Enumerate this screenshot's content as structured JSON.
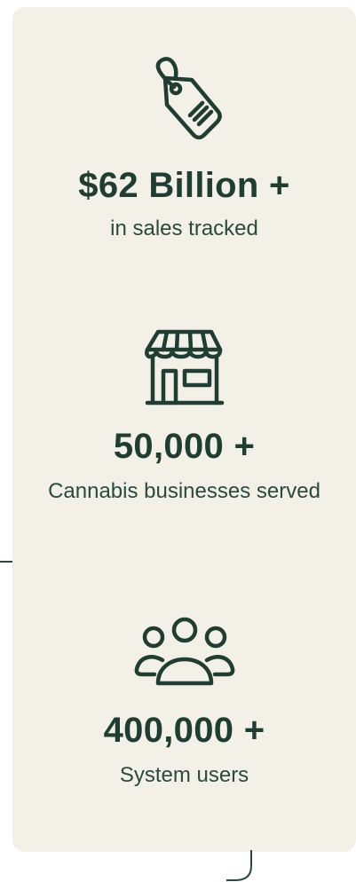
{
  "stats": [
    {
      "value": "$62 Billion +",
      "label": "in sales tracked",
      "icon": "price-tag-icon"
    },
    {
      "value": "50,000 +",
      "label": "Cannabis businesses served",
      "icon": "storefront-icon"
    },
    {
      "value": "400,000 +",
      "label": "System users",
      "icon": "users-group-icon"
    }
  ],
  "colors": {
    "card_background": "#f3f1e7",
    "text": "#1f3d33"
  }
}
